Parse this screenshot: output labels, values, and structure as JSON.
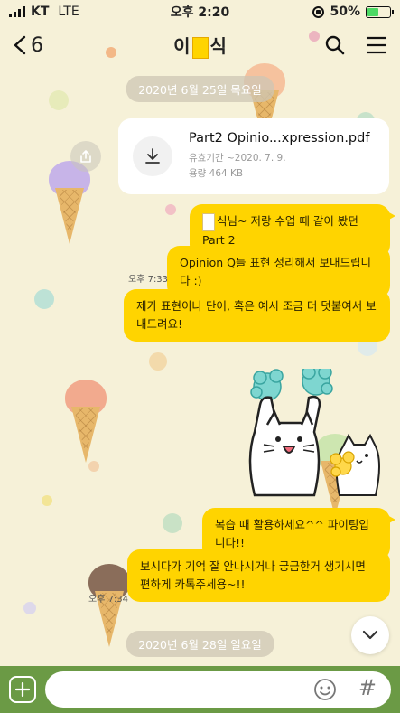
{
  "status_bar": {
    "carrier": "KT",
    "network": "LTE",
    "time": "오후 2:20",
    "battery_percent": "50%",
    "battery_level": 0.5
  },
  "header": {
    "back_count": "6",
    "title_left": "이",
    "title_right": "식",
    "icons": [
      "chevron-left-icon",
      "search-icon",
      "menu-icon"
    ]
  },
  "date_dividers": [
    "2020년 6월 25일 목요일",
    "2020년 6월 28일 일요일"
  ],
  "file_message": {
    "name": "Part2 Opinio...xpression.pdf",
    "validity_label": "유효기간 ~2020. 7. 9.",
    "size_label": "용량 464 KB",
    "icons": [
      "download-icon",
      "share-icon"
    ]
  },
  "messages": [
    {
      "text": "식님~ 저랑 수업 때 같이 봤던 Part 2",
      "name_masked": true
    },
    {
      "text": "Opinion Q들 표현 정리해서 보내드립니다 :)"
    },
    {
      "text": "제가 표현이나 단어, 혹은 예시 조금 더 덧붙여서 보내드려요!"
    },
    {
      "text": "복습 때 활용하세요^^ 파이팅입니다!!"
    },
    {
      "text": "보시다가 기억 잘 안나시거나 궁금한거 생기시면 편하게 카톡주세용~!!"
    }
  ],
  "timestamps": [
    "오후 7:33",
    "오후 7:34"
  ],
  "input_bar": {
    "placeholder": "",
    "hash_label": "#",
    "icons": [
      "plus-icon",
      "emoji-icon"
    ]
  },
  "colors": {
    "bubble": "#ffd400",
    "background": "#f6f1d8",
    "input_bar": "#6b9a45"
  }
}
